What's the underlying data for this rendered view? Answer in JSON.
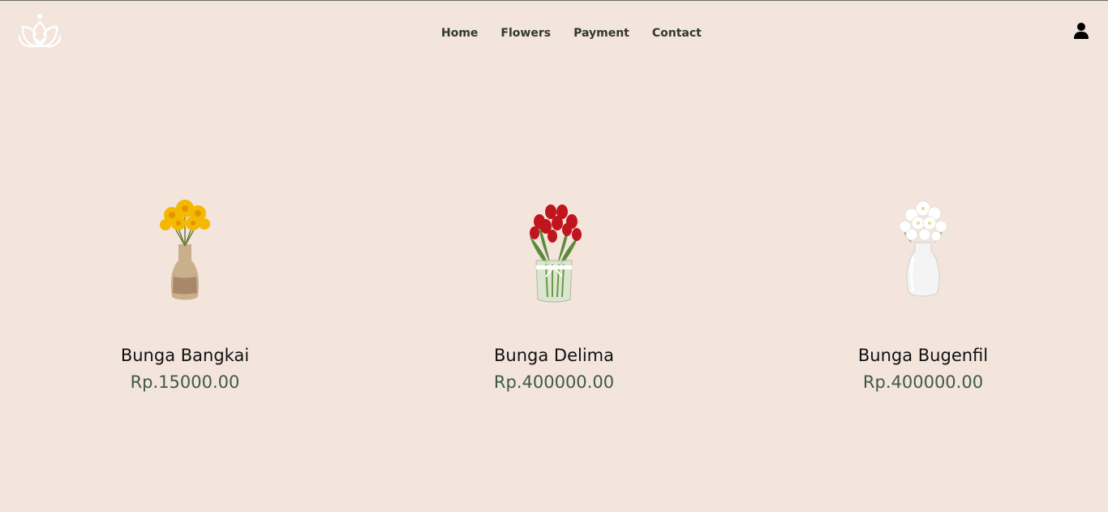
{
  "nav": {
    "items": [
      {
        "label": "Home"
      },
      {
        "label": "Flowers"
      },
      {
        "label": "Payment"
      },
      {
        "label": "Contact"
      }
    ]
  },
  "icons": {
    "logo": "lotus-logo-icon",
    "user": "user-icon"
  },
  "products": [
    {
      "name": "Bunga Bangkai",
      "price": "Rp.15000.00",
      "image": "yellow-sunflowers-in-vase"
    },
    {
      "name": "Bunga Delima",
      "price": "Rp.400000.00",
      "image": "red-tulips-in-glass-vase"
    },
    {
      "name": "Bunga Bugenfil",
      "price": "Rp.400000.00",
      "image": "white-flowers-in-white-vase"
    }
  ],
  "colors": {
    "background": "#f3e4dc",
    "nav_text": "#2e3a2b",
    "price": "#3f5a4a"
  }
}
